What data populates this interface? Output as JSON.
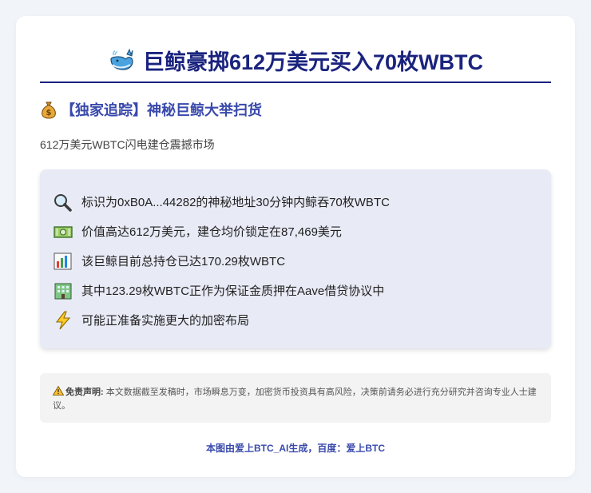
{
  "header": {
    "icon": "whale-icon",
    "title": "巨鲸豪掷612万美元买入70枚WBTC"
  },
  "subheader": {
    "icon": "money-bag-icon",
    "title": "【独家追踪】神秘巨鲸大举扫货"
  },
  "tagline": "612万美元WBTC闪电建仓震撼市场",
  "points": [
    {
      "icon": "magnifier-icon",
      "text": "标识为0xB0A...44282的神秘地址30分钟内鲸吞70枚WBTC"
    },
    {
      "icon": "banknote-icon",
      "text": "价值高达612万美元，建仓均价锁定在87,469美元"
    },
    {
      "icon": "bar-chart-icon",
      "text": "该巨鲸目前总持仓已达170.29枚WBTC"
    },
    {
      "icon": "bank-building-icon",
      "text": "其中123.29枚WBTC正作为保证金质押在Aave借贷协议中"
    },
    {
      "icon": "lightning-icon",
      "text": "可能正准备实施更大的加密布局"
    }
  ],
  "disclaimer": {
    "icon": "warning-icon",
    "label": "免责声明:",
    "text": "本文数据截至发稿时，市场瞬息万变，加密货币投资具有高风险，决策前请务必进行充分研究并咨询专业人士建议。"
  },
  "footer": "本图由爱上BTC_AI生成，百度：爱上BTC",
  "colors": {
    "accent": "#1a237e",
    "sub_accent": "#3949ab",
    "panel_bg": "#e8eaf6",
    "page_bg": "#f1f4f9"
  }
}
